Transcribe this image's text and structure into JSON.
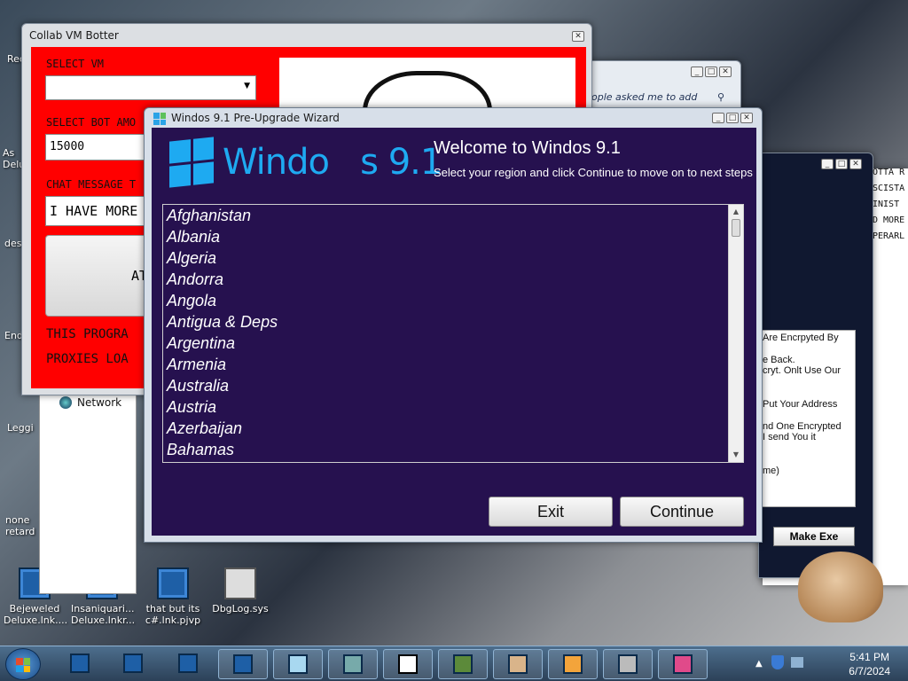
{
  "desktop": {
    "icons": [
      {
        "label": "Bejeweled Deluxe.lnk...."
      },
      {
        "label": "Insaniquari... Deluxe.lnkr..."
      },
      {
        "label": "that but its c#.lnk.pjvp"
      },
      {
        "label": "DbgLog.sys"
      }
    ],
    "side_labels": [
      "Rec",
      "As Delu",
      "des",
      "End",
      "Leggi",
      "none retard"
    ],
    "explorer_item": "Network"
  },
  "botter": {
    "title": "Collab VM Botter",
    "select_vm_label": "SELECT VM",
    "select_vm_value": "",
    "bot_amount_label": "SELECT BOT AMO",
    "bot_amount_value": "15000",
    "chat_label": "CHAT MESSAGE T",
    "chat_value": "I HAVE MORE",
    "attack_label": "AT",
    "warning_line1": "THIS PROGRA",
    "warning_line2": "PROXIES LOA"
  },
  "bg_window": {
    "search_text": "ople asked me to add"
  },
  "wizard": {
    "title": "Windos 9.1 Pre-Upgrade Wizard",
    "logo_text": "Windo   s 9.1",
    "heading": "Welcome to Windos 9.1",
    "subheading": "Select your region and click Continue to move on to next steps",
    "regions": [
      "Afghanistan",
      "Albania",
      "Algeria",
      "Andorra",
      "Angola",
      "Antigua & Deps",
      "Argentina",
      "Armenia",
      "Australia",
      "Austria",
      "Azerbaijan",
      "Bahamas"
    ],
    "exit_label": "Exit",
    "continue_label": "Continue"
  },
  "console": {
    "lines": [
      "OTTA R",
      "",
      "SCISTA",
      "INIST",
      "D MORE",
      "PERARL"
    ],
    "message_lines": [
      "Are Encrpyted By",
      "",
      "e Back.",
      "cryt. Onlt Use Our",
      "",
      "",
      "Put Your Address",
      "",
      "nd One Encrypted",
      "I send You it",
      "",
      "",
      "me)"
    ],
    "make_exe_label": "Make Exe"
  },
  "taskbar": {
    "time": "5:41 PM",
    "date": "6/7/2024"
  },
  "colors": {
    "wizard_bg": "#26114f",
    "logo_blue": "#1eaaf1",
    "botter_red": "#ff0000"
  }
}
